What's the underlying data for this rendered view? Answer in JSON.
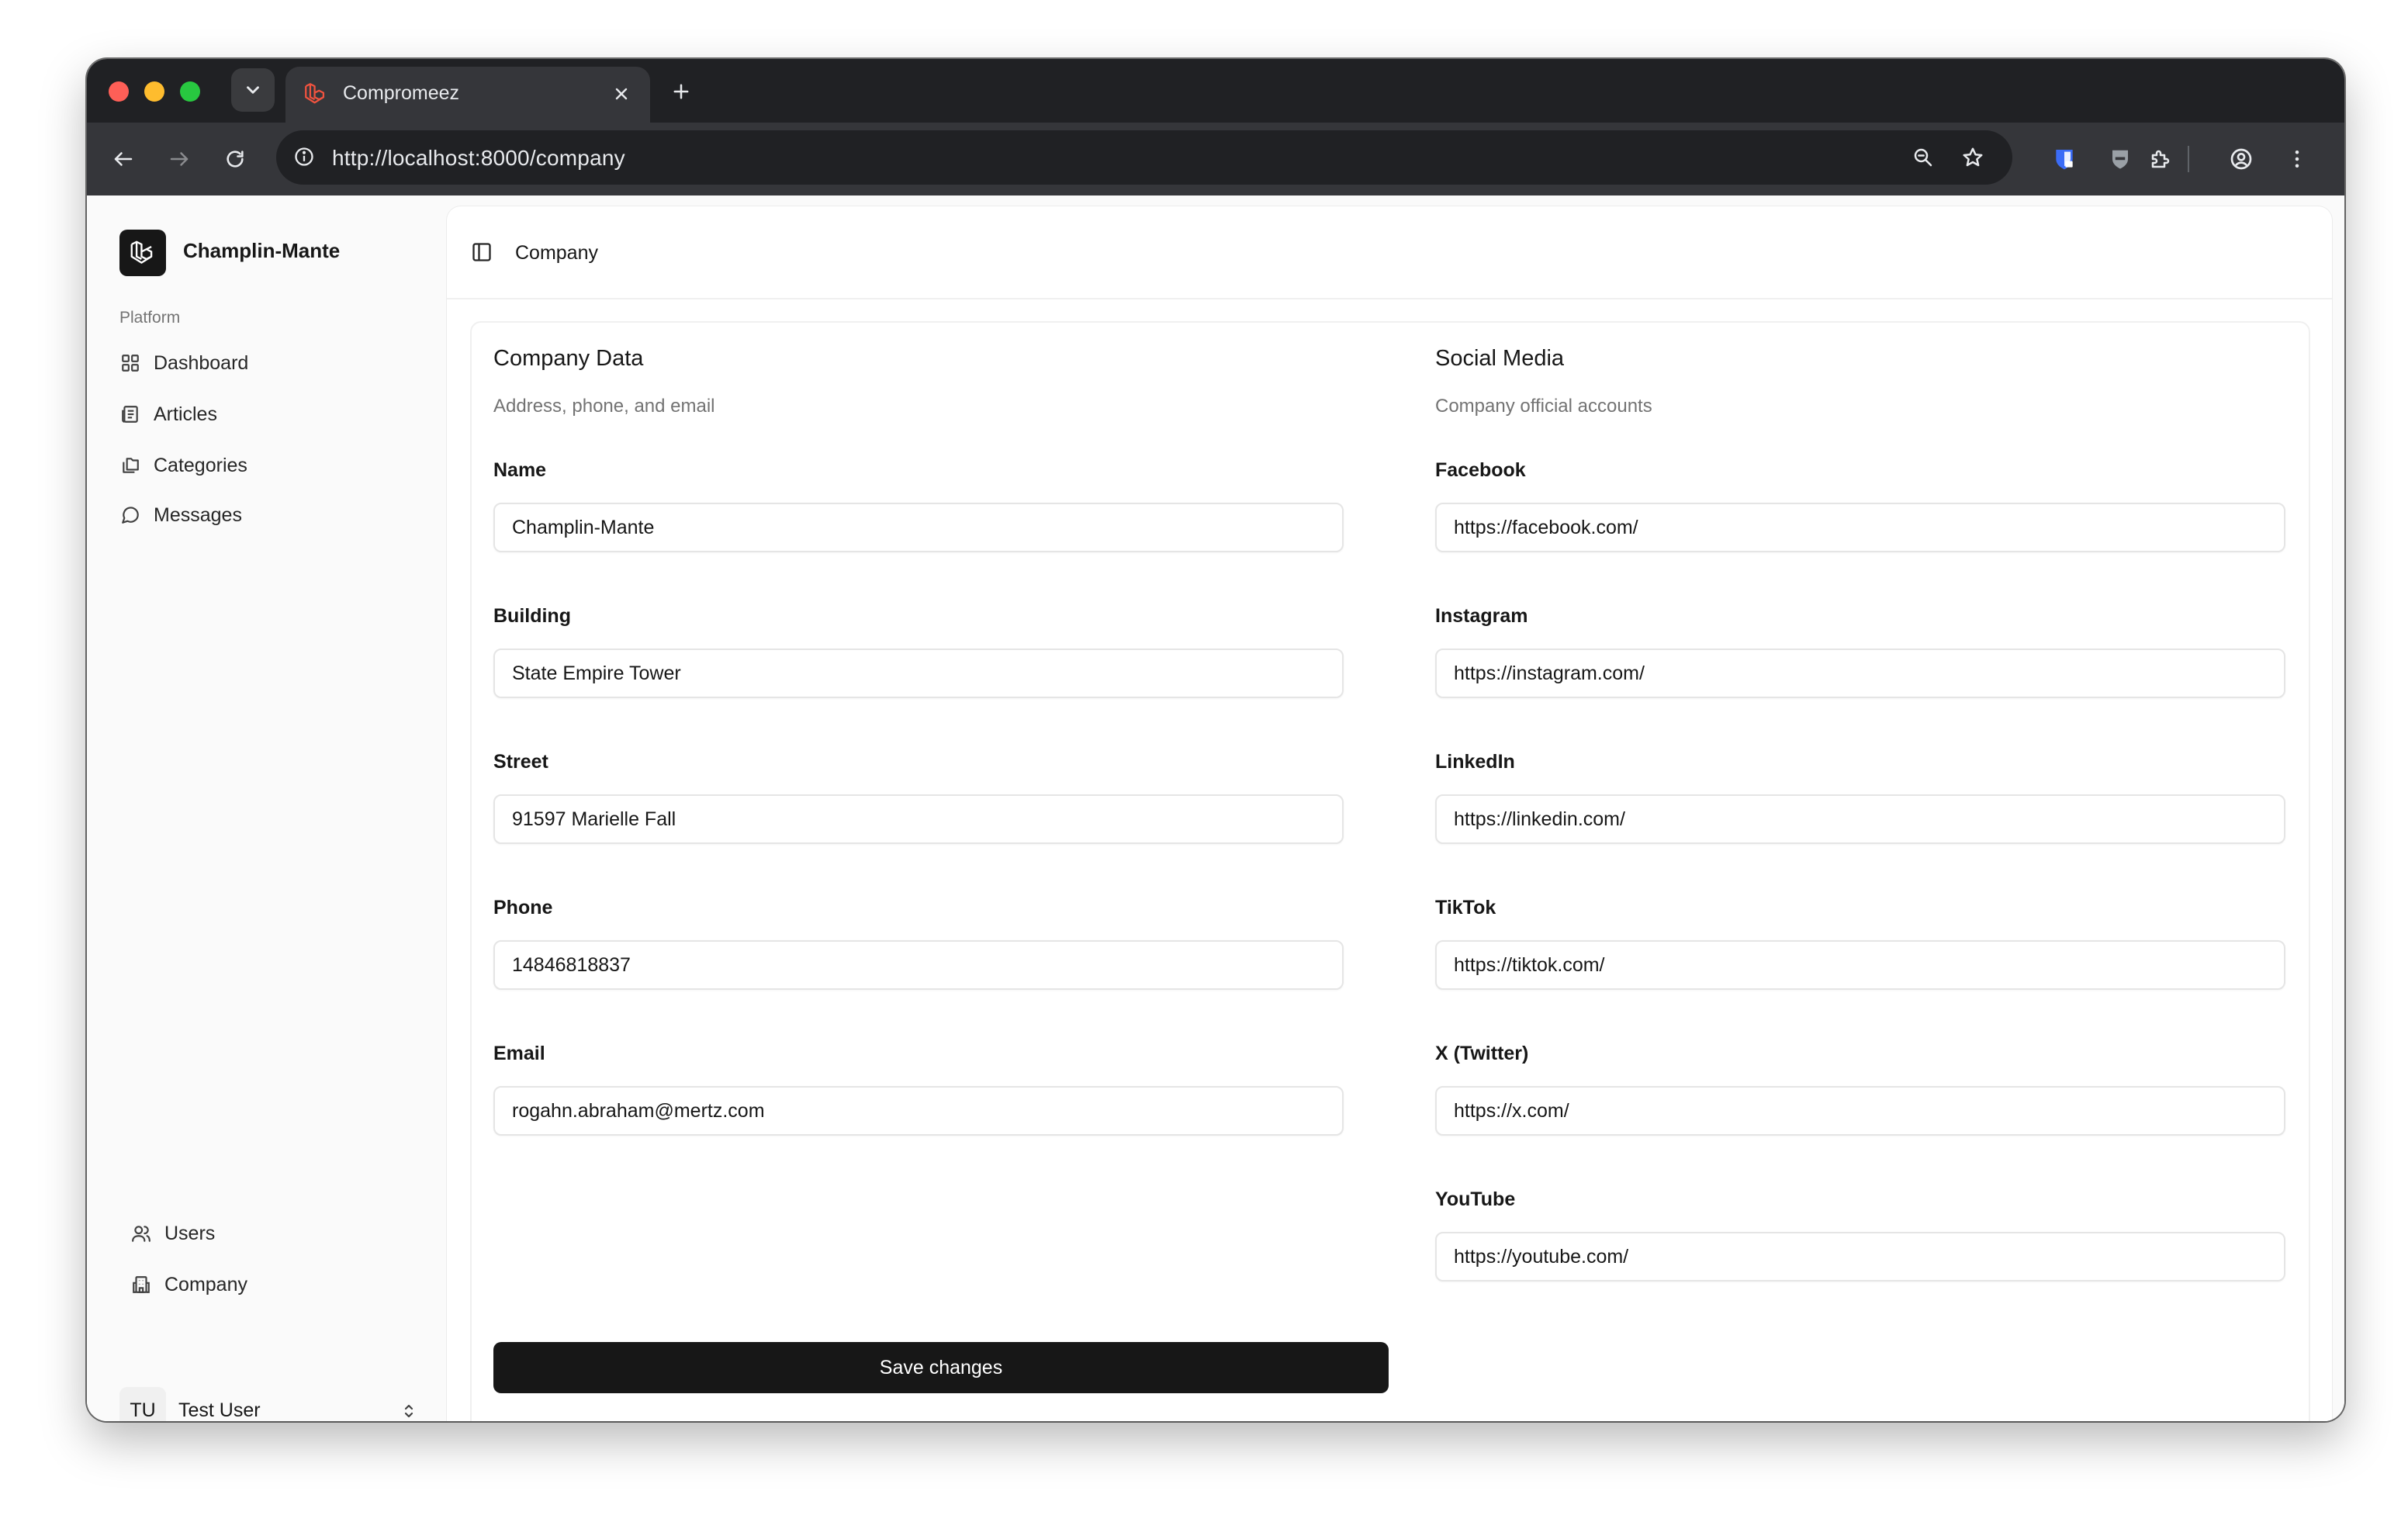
{
  "browser": {
    "tab_title": "Compromeez",
    "url": "http://localhost:8000/company"
  },
  "sidebar": {
    "brand": "Champlin-Mante",
    "group_label": "Platform",
    "nav": [
      {
        "label": "Dashboard",
        "icon": "grid-icon"
      },
      {
        "label": "Articles",
        "icon": "newspaper-icon"
      },
      {
        "label": "Categories",
        "icon": "folders-icon"
      },
      {
        "label": "Messages",
        "icon": "message-circle-icon"
      }
    ],
    "footer_nav": [
      {
        "label": "Users",
        "icon": "users-icon"
      },
      {
        "label": "Company",
        "icon": "building-icon"
      }
    ],
    "user": {
      "initials": "TU",
      "name": "Test User"
    }
  },
  "header": {
    "breadcrumb": "Company"
  },
  "company_data": {
    "title": "Company Data",
    "description": "Address, phone, and email",
    "fields": [
      {
        "label": "Name",
        "value": "Champlin-Mante"
      },
      {
        "label": "Building",
        "value": "State Empire Tower"
      },
      {
        "label": "Street",
        "value": "91597 Marielle Fall"
      },
      {
        "label": "Phone",
        "value": "14846818837"
      },
      {
        "label": "Email",
        "value": "rogahn.abraham@mertz.com"
      }
    ]
  },
  "social_media": {
    "title": "Social Media",
    "description": "Company official accounts",
    "fields": [
      {
        "label": "Facebook",
        "value": "https://facebook.com/"
      },
      {
        "label": "Instagram",
        "value": "https://instagram.com/"
      },
      {
        "label": "LinkedIn",
        "value": "https://linkedin.com/"
      },
      {
        "label": "TikTok",
        "value": "https://tiktok.com/"
      },
      {
        "label": "X (Twitter)",
        "value": "https://x.com/"
      },
      {
        "label": "YouTube",
        "value": "https://youtube.com/"
      }
    ]
  },
  "actions": {
    "save_label": "Save changes"
  },
  "colors": {
    "primary": "#171717",
    "muted_text": "#737373",
    "border": "#e5e5e5",
    "sidebar_bg": "#fafafa"
  }
}
